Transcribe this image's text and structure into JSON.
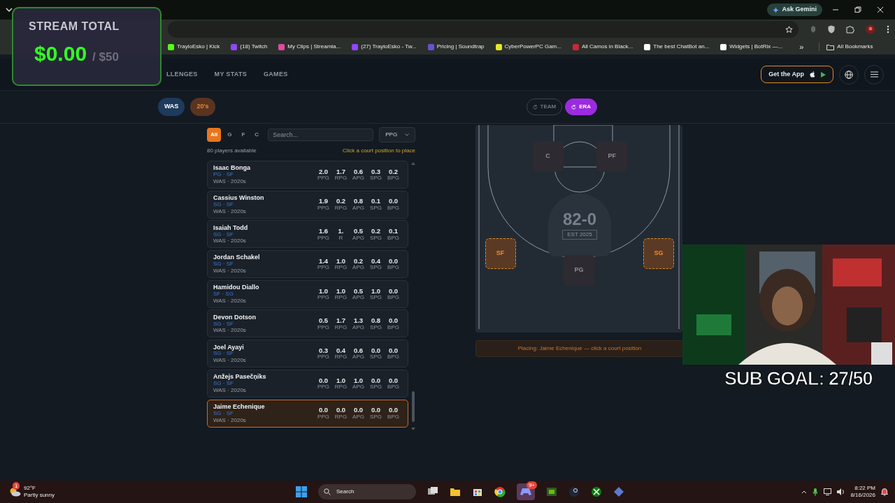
{
  "browser": {
    "gemini_button": "Ask Gemini",
    "bookmarks": [
      {
        "label": "TrayloEsko | Kick",
        "color": "#53fc18"
      },
      {
        "label": "(18) Twitch",
        "color": "#9146ff"
      },
      {
        "label": "My Clips | Streamla...",
        "color": "#e04aa0"
      },
      {
        "label": "(27) TrayloEsko - Tw...",
        "color": "#9146ff"
      },
      {
        "label": "Pricing | Soundtrap",
        "color": "#6a4fd6"
      },
      {
        "label": "CyberPowerPC Gam...",
        "color": "#e6e62a"
      },
      {
        "label": "All Camos in Black...",
        "color": "#c8283a"
      },
      {
        "label": "The best ChatBot an...",
        "color": "#ffffff"
      },
      {
        "label": "Widgets | BotRix —...",
        "color": "#ffffff"
      }
    ],
    "more_bookmarks": "»",
    "all_bookmarks": "All Bookmarks"
  },
  "site_nav": {
    "items": [
      "LLENGES",
      "MY STATS",
      "GAMES"
    ],
    "app_button": "Get the App"
  },
  "filters": {
    "chips": [
      {
        "label": "WAS",
        "color": "#1e3a5c"
      },
      {
        "label": "20's",
        "color": "#5a3420"
      }
    ],
    "toggles": [
      {
        "label": "TEAM",
        "selected": false
      },
      {
        "label": "ERA",
        "selected": true
      }
    ]
  },
  "player_panel": {
    "positions": [
      {
        "label": "All",
        "selected": true
      },
      {
        "label": "G",
        "selected": false
      },
      {
        "label": "F",
        "selected": false
      },
      {
        "label": "C",
        "selected": false
      }
    ],
    "search_placeholder": "Search...",
    "sort": "PPG",
    "count": "80 players available",
    "hint": "Click a court position to place",
    "players": [
      {
        "name": "Isaac Bonga",
        "positions": "PG · SF",
        "team": "WAS · 2020s",
        "selected": false,
        "stats": [
          {
            "value": "2.0",
            "label": "PPG"
          },
          {
            "value": "1.7",
            "label": "RPG"
          },
          {
            "value": "0.6",
            "label": "APG"
          },
          {
            "value": "0.3",
            "label": "SPG"
          },
          {
            "value": "0.2",
            "label": "BPG"
          }
        ]
      },
      {
        "name": "Cassius Winston",
        "positions": "SG · SF",
        "team": "WAS · 2020s",
        "selected": false,
        "stats": [
          {
            "value": "1.9",
            "label": "PPG"
          },
          {
            "value": "0.2",
            "label": "RPG"
          },
          {
            "value": "0.8",
            "label": "APG"
          },
          {
            "value": "0.1",
            "label": "SPG"
          },
          {
            "value": "0.0",
            "label": "BPG"
          }
        ]
      },
      {
        "name": "Isaiah Todd",
        "positions": "SG · SF",
        "team": "WAS · 2020s",
        "selected": false,
        "stats": [
          {
            "value": "1.6",
            "label": "PPG"
          },
          {
            "value": "1.",
            "label": "R"
          },
          {
            "value": "0.5",
            "label": "APG"
          },
          {
            "value": "0.2",
            "label": "SPG"
          },
          {
            "value": "0.1",
            "label": "BPG"
          }
        ]
      },
      {
        "name": "Jordan Schakel",
        "positions": "SG · SF",
        "team": "WAS · 2020s",
        "selected": false,
        "stats": [
          {
            "value": "1.4",
            "label": "PPG"
          },
          {
            "value": "1.0",
            "label": "RPG"
          },
          {
            "value": "0.2",
            "label": "APG"
          },
          {
            "value": "0.4",
            "label": "SPG"
          },
          {
            "value": "0.0",
            "label": "BPG"
          }
        ]
      },
      {
        "name": "Hamidou Diallo",
        "positions": "SF · SG",
        "team": "WAS · 2020s",
        "selected": false,
        "stats": [
          {
            "value": "1.0",
            "label": "PPG"
          },
          {
            "value": "1.0",
            "label": "RPG"
          },
          {
            "value": "0.5",
            "label": "APG"
          },
          {
            "value": "1.0",
            "label": "SPG"
          },
          {
            "value": "0.0",
            "label": "BPG"
          }
        ]
      },
      {
        "name": "Devon Dotson",
        "positions": "SG · SF",
        "team": "WAS · 2020s",
        "selected": false,
        "stats": [
          {
            "value": "0.5",
            "label": "PPG"
          },
          {
            "value": "1.7",
            "label": "RPG"
          },
          {
            "value": "1.3",
            "label": "APG"
          },
          {
            "value": "0.8",
            "label": "SPG"
          },
          {
            "value": "0.0",
            "label": "BPG"
          }
        ]
      },
      {
        "name": "Joel Ayayi",
        "positions": "SG · SF",
        "team": "WAS · 2020s",
        "selected": false,
        "stats": [
          {
            "value": "0.3",
            "label": "PPG"
          },
          {
            "value": "0.4",
            "label": "RPG"
          },
          {
            "value": "0.6",
            "label": "APG"
          },
          {
            "value": "0.0",
            "label": "SPG"
          },
          {
            "value": "0.0",
            "label": "BPG"
          }
        ]
      },
      {
        "name": "Anžejs Pasečņiks",
        "positions": "SG · SF",
        "team": "WAS · 2020s",
        "selected": false,
        "stats": [
          {
            "value": "0.0",
            "label": "PPG"
          },
          {
            "value": "1.0",
            "label": "RPG"
          },
          {
            "value": "1.0",
            "label": "APG"
          },
          {
            "value": "0.0",
            "label": "SPG"
          },
          {
            "value": "0.0",
            "label": "BPG"
          }
        ]
      },
      {
        "name": "Jaime Echenique",
        "positions": "SG · SF",
        "team": "WAS · 2020s",
        "selected": true,
        "stats": [
          {
            "value": "0.0",
            "label": "PPG"
          },
          {
            "value": "0.0",
            "label": "RPG"
          },
          {
            "value": "0.0",
            "label": "APG"
          },
          {
            "value": "0.0",
            "label": "SPG"
          },
          {
            "value": "0.0",
            "label": "BPG"
          }
        ]
      }
    ]
  },
  "court": {
    "slots": [
      {
        "label": "C",
        "available": false
      },
      {
        "label": "PF",
        "available": false
      },
      {
        "label": "SF",
        "available": true
      },
      {
        "label": "SG",
        "available": true
      },
      {
        "label": "PG",
        "available": false
      }
    ],
    "logo_text": "82-0",
    "logo_subtext": "EST 2025",
    "placing": "Placing: Jaime Echenique — click a court position"
  },
  "overlay": {
    "title": "STREAM TOTAL",
    "amount": "$0.00",
    "goal": "/ $50",
    "sub_goal": "SUB GOAL: 27/50"
  },
  "taskbar": {
    "weather_badge": "1",
    "temperature": "92°F",
    "weather": "Partly sunny",
    "search": "Search",
    "chat_badge": "9+",
    "time": "8:22 PM",
    "date": "8/16/2026"
  }
}
